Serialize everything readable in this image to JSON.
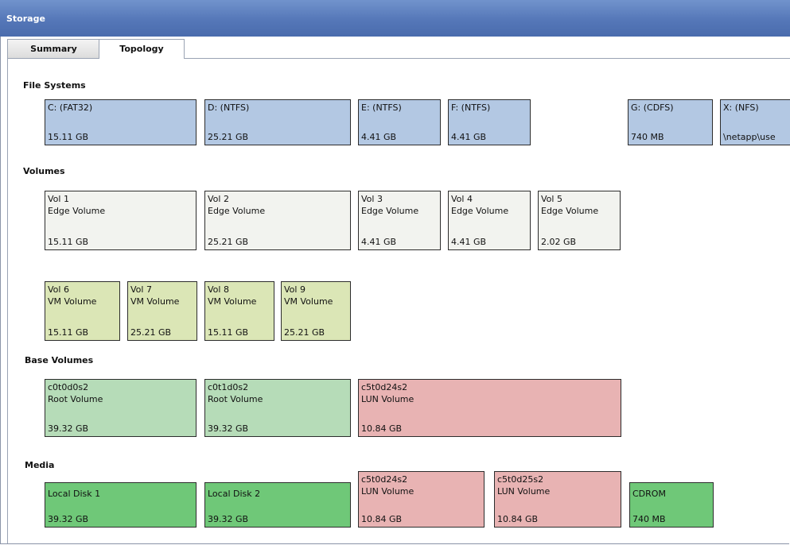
{
  "window": {
    "title": "Storage"
  },
  "tabs": [
    {
      "label": "Summary",
      "active": false
    },
    {
      "label": "Topology",
      "active": true
    }
  ],
  "sections": {
    "file_systems": "File Systems",
    "volumes": "Volumes",
    "base_volumes": "Base Volumes",
    "media": "Media"
  },
  "file_systems": [
    {
      "name": "C: (FAT32)",
      "size": "15.11 GB"
    },
    {
      "name": "D: (NTFS)",
      "size": "25.21 GB"
    },
    {
      "name": "E: (NTFS)",
      "size": "4.41 GB"
    },
    {
      "name": "F: (NTFS)",
      "size": "4.41 GB"
    },
    {
      "name": "G: (CDFS)",
      "size": "740 MB"
    },
    {
      "name": "X: (NFS)",
      "size": "\\netapp\\use"
    }
  ],
  "edge_volumes": [
    {
      "name": "Vol 1",
      "type": "Edge Volume",
      "size": "15.11 GB"
    },
    {
      "name": "Vol 2",
      "type": "Edge Volume",
      "size": "25.21 GB"
    },
    {
      "name": "Vol 3",
      "type": "Edge Volume",
      "size": "4.41 GB"
    },
    {
      "name": "Vol 4",
      "type": "Edge Volume",
      "size": "4.41 GB"
    },
    {
      "name": "Vol 5",
      "type": "Edge Volume",
      "size": "2.02 GB"
    }
  ],
  "vm_volumes": [
    {
      "name": "Vol 6",
      "type": "VM Volume",
      "size": "15.11 GB"
    },
    {
      "name": "Vol 7",
      "type": "VM Volume",
      "size": "25.21 GB"
    },
    {
      "name": "Vol 8",
      "type": "VM Volume",
      "size": "15.11 GB"
    },
    {
      "name": "Vol 9",
      "type": "VM Volume",
      "size": "25.21 GB"
    }
  ],
  "base_volumes": [
    {
      "name": "c0t0d0s2",
      "type": "Root Volume",
      "size": "39.32 GB"
    },
    {
      "name": "c0t1d0s2",
      "type": "Root Volume",
      "size": "39.32 GB"
    },
    {
      "name": "c5t0d24s2",
      "type": "LUN Volume",
      "size": "10.84 GB"
    }
  ],
  "media": [
    {
      "name": "Local Disk 1",
      "size": "39.32 GB"
    },
    {
      "name": "Local Disk 2",
      "size": "39.32 GB"
    },
    {
      "name": "c5t0d24s2",
      "type": "LUN Volume",
      "size": "10.84 GB"
    },
    {
      "name": "c5t0d25s2",
      "type": "LUN Volume",
      "size": "10.84 GB"
    },
    {
      "name": "CDROM",
      "size": "740 MB"
    }
  ],
  "colors": {
    "titlebar": "#5577b8",
    "file_system": "#b3c8e3",
    "edge_volume": "#f2f3ef",
    "vm_volume": "#dbe6b6",
    "root_volume": "#b6dcb8",
    "lun_volume": "#e8b3b3",
    "disk": "#6fc878"
  }
}
